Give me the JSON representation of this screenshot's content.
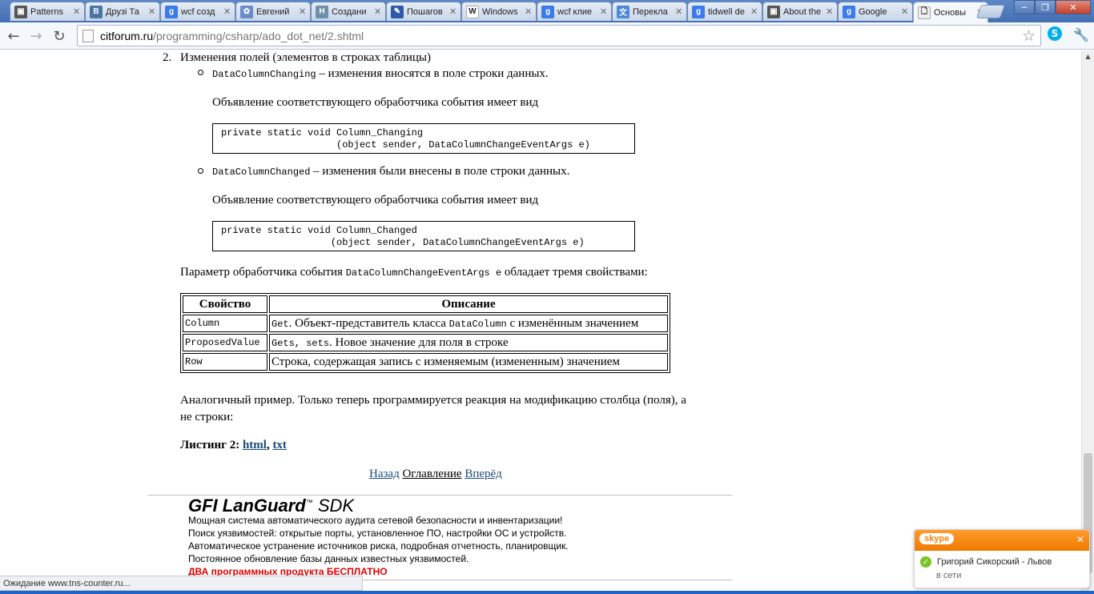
{
  "browser": {
    "tabs": [
      {
        "title": "Patterns",
        "favicon": "image-icon",
        "color": "#555555",
        "glyph": "▣"
      },
      {
        "title": "Друзі Та",
        "favicon": "vk-icon",
        "color": "#4c75a3",
        "glyph": "В"
      },
      {
        "title": "wcf созд",
        "favicon": "google-icon",
        "color": "#3b7be9",
        "glyph": "g"
      },
      {
        "title": "Евгений",
        "favicon": "people-icon",
        "color": "#6a8ccc",
        "glyph": "✿"
      },
      {
        "title": "Создани",
        "favicon": "habr-icon",
        "color": "#6d8fa8",
        "glyph": "H"
      },
      {
        "title": "Пошагов",
        "favicon": "pen-icon",
        "color": "#2d5aa8",
        "glyph": "✎"
      },
      {
        "title": "Windows",
        "favicon": "wikipedia-icon",
        "color": "#ffffff",
        "glyph": "W"
      },
      {
        "title": "wcf клие",
        "favicon": "google-icon",
        "color": "#3b7be9",
        "glyph": "g"
      },
      {
        "title": "Перекла",
        "favicon": "translate-icon",
        "color": "#4d87d6",
        "glyph": "文"
      },
      {
        "title": "tidwell de",
        "favicon": "google-icon",
        "color": "#3b7be9",
        "glyph": "g"
      },
      {
        "title": "About the",
        "favicon": "image-icon",
        "color": "#555555",
        "glyph": "▣"
      },
      {
        "title": "Google",
        "favicon": "google-icon",
        "color": "#3b7be9",
        "glyph": "g"
      },
      {
        "title": "Основы",
        "favicon": "page-icon",
        "color": "#eeeeee",
        "glyph": "🗋",
        "active": true
      }
    ],
    "url_host": "citforum.ru",
    "url_path": "/programming/csharp/ado_dot_net/2.shtml",
    "status_text": "Ожидание www.tns-counter.ru..."
  },
  "article": {
    "item_number": "2.",
    "item_title": "Изменения полей (элементов в строках таблицы)",
    "events": [
      {
        "name": "DataColumnChanging",
        "desc": " – изменения вносятся в поле строки данных.",
        "decl_intro": "Объявление соответствующего обработчика события имеет вид",
        "code_line1": "private static void Column_Changing",
        "code_line2": "                    (object sender, DataColumnChangeEventArgs e)"
      },
      {
        "name": "DataColumnChanged",
        "desc": " – изменения были внесены в поле строки данных.",
        "decl_intro": "Объявление соответствующего обработчика события имеет вид",
        "code_line1": "private static void Column_Changed",
        "code_line2": "                   (object sender, DataColumnChangeEventArgs e)"
      }
    ],
    "param_prefix": "Параметр обработчика события ",
    "param_code": "DataColumnChangeEventArgs e",
    "param_suffix": " обладает тремя свойствами:",
    "table": {
      "headers": [
        "Свойство",
        "Описание"
      ],
      "rows": [
        {
          "prop": "Column",
          "code": "Get",
          "text": ". Объект-представитель класса ",
          "code2": "DataColumn",
          "text2": " с изменённым значением"
        },
        {
          "prop": "ProposedValue",
          "code": "Gets, sets",
          "text": ". Новое значение для поля в строке",
          "code2": "",
          "text2": ""
        },
        {
          "prop": "Row",
          "code": "",
          "text": "Строка, содержащая запись с изменяемым (измененным) значением",
          "code2": "",
          "text2": ""
        }
      ]
    },
    "example_line1": "Аналогичный пример. Только теперь программируется реакция на модификацию столбца (поля), а",
    "example_line2": "не строки:",
    "listing_label": "Листинг 2:",
    "listing_html": "html",
    "listing_sep": ",",
    "listing_txt": "txt",
    "nav": {
      "back": "Назад",
      "toc": "Оглавление",
      "forward": "Вперёд"
    }
  },
  "ad": {
    "brand_gfi": "GFI",
    "brand_product": "LanGuard",
    "brand_sdk": "SDK",
    "lines": [
      "Мощная система автоматического аудита сетевой безопасности и инвентаризации!",
      "Поиск уязвимостей: открытые порты, установленное ПО, настройки ОС и устройств.",
      "Автоматическое устранение источников риска, подробная отчетность, планировщик.",
      "Постоянное обновление базы данных известных уязвимостей."
    ],
    "highlight": "ДВА программных продукта БЕСПЛАТНО"
  },
  "skype": {
    "logo": "skype",
    "contact": "Григорий Сикорский - Львов",
    "status": "в сети"
  }
}
